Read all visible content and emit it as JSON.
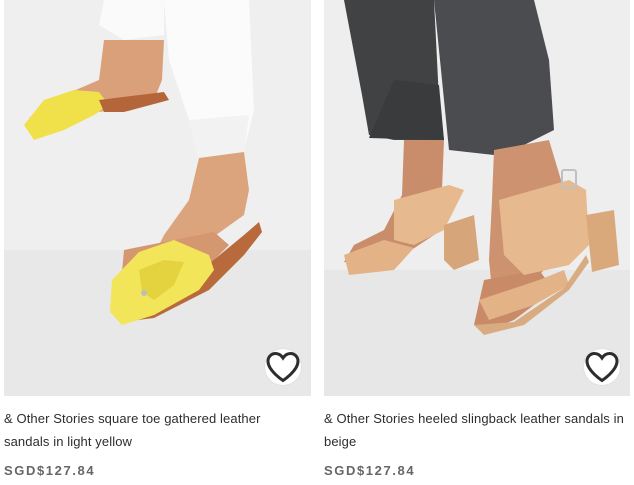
{
  "products": [
    {
      "title": "& Other Stories square toe gathered leather sandals in light yellow",
      "price": "SGD$127.84",
      "color_accent": "#f3e55a",
      "wishlist_icon": "heart-outline-icon"
    },
    {
      "title": "& Other Stories heeled slingback leather sandals in beige",
      "price": "SGD$127.84",
      "color_accent": "#e6b98e",
      "wishlist_icon": "heart-outline-icon"
    }
  ]
}
